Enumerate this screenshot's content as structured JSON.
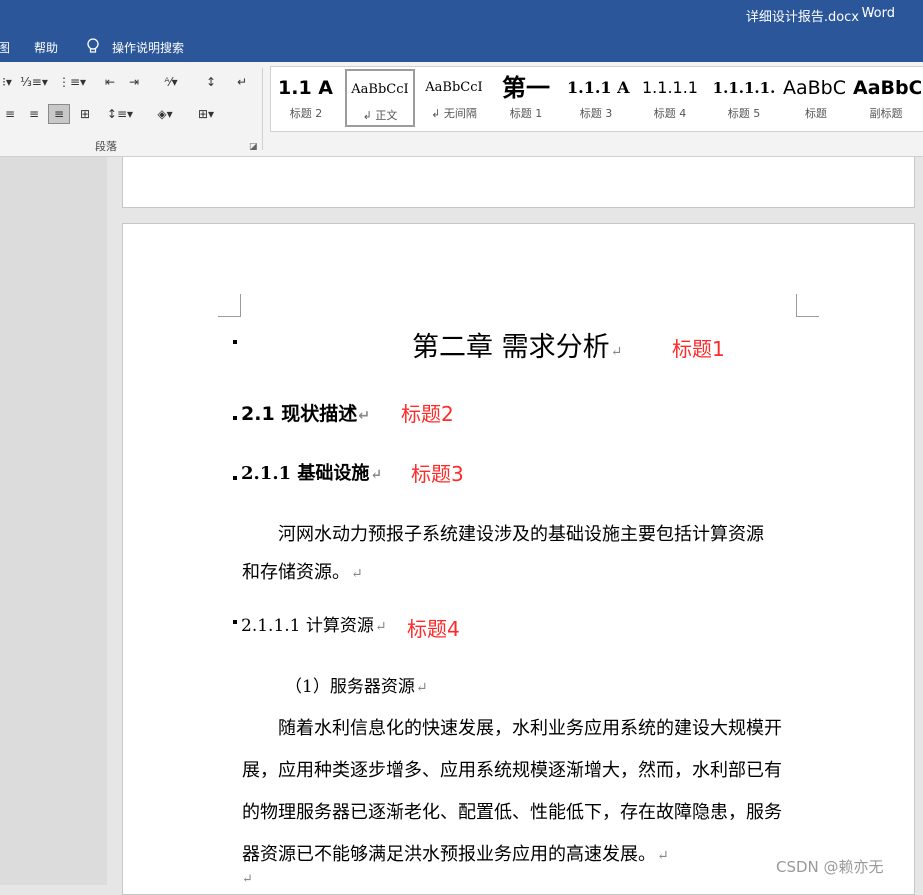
{
  "window": {
    "doc_title": "详细设计报告.docx",
    "separator": "-",
    "app_name": "Word"
  },
  "menu": {
    "partial_tab": "图",
    "help": "帮助",
    "tell_me": "操作说明搜索"
  },
  "ribbon": {
    "paragraph_group_label": "段落",
    "styles": [
      {
        "preview": "1.1 A",
        "label": "标题 2"
      },
      {
        "preview": "AaBbCcI",
        "label": "↲ 正文",
        "selected": true
      },
      {
        "preview": "AaBbCcI",
        "label": "↲ 无间隔"
      },
      {
        "preview": "第一",
        "label": "标题 1"
      },
      {
        "preview": "1.1.1 A",
        "label": "标题 3"
      },
      {
        "preview": "1.1.1.1",
        "label": "标题 4"
      },
      {
        "preview": "1.1.1.1.",
        "label": "标题 5"
      },
      {
        "preview": "AaBbC",
        "label": "标题"
      },
      {
        "preview": "AaBbC",
        "label": "副标题"
      }
    ]
  },
  "document": {
    "para_mark": "↵",
    "h1": "第二章 需求分析",
    "h2": "2.1 现状描述",
    "h3": "2.1.1 基础设施",
    "p1_line1": "河网水动力预报子系统建设涉及的基础设施主要包括计算资源",
    "p1_line2": "和存储资源。",
    "h4": "2.1.1.1 计算资源",
    "item1": "（1）服务器资源",
    "p2_line1": "随着水利信息化的快速发展，水利业务应用系统的建设大规模开",
    "p2_line2": "展，应用种类逐步增多、应用系统规模逐渐增大，然而，水利部已有",
    "p2_line3": "的物理服务器已逐渐老化、配置低、性能低下，存在故障隐患，服务",
    "p2_line4": "器资源已不能够满足洪水预报业务应用的高速发展。"
  },
  "annotations": {
    "a1": "标题1",
    "a2": "标题2",
    "a3": "标题3",
    "a4": "标题4"
  },
  "watermark": "CSDN @赖亦无",
  "colors": {
    "title_bar": "#2b579a",
    "annotation": "#ff2a2a"
  }
}
